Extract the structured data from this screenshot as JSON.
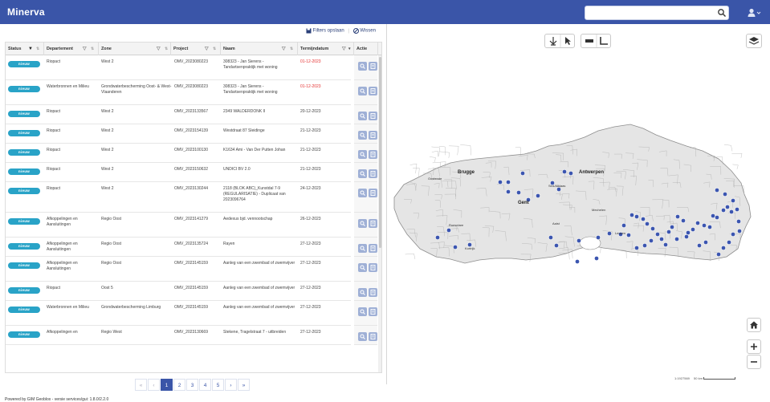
{
  "app": {
    "title": "Minerva"
  },
  "search": {
    "placeholder": "",
    "value": ""
  },
  "filters": {
    "save_label": "Filters opslaan",
    "separator": "|",
    "clear_label": "Wissen"
  },
  "table": {
    "headers": {
      "status": "Status",
      "departement": "Departement",
      "zone": "Zone",
      "project": "Project",
      "naam": "Naam",
      "termijndatum": "Termijndatum",
      "actie": "Actie"
    },
    "rows": [
      {
        "status": "nieuw",
        "departement": "Riopact",
        "zone": "West 2",
        "project": "OMV_2023080223",
        "naam": "308323 - Jan Sierens - Tandartsenpraktijk met woning",
        "termijndatum": "01-12-2023",
        "overdue": true
      },
      {
        "status": "nieuw",
        "departement": "Waterbronnen en Milieu",
        "zone": "Grondwaterbescherming Oost- & West-Vlaanderen",
        "project": "OMV_2023080223",
        "naam": "308323 - Jan Sierens - Tandartsenpraktijk met woning",
        "termijndatum": "01-12-2023",
        "overdue": true
      },
      {
        "status": "nieuw",
        "departement": "Riopact",
        "zone": "West 2",
        "project": "OMV_2023133567",
        "naam": "2349 WALDERDONK II",
        "termijndatum": "20-12-2023",
        "overdue": false
      },
      {
        "status": "nieuw",
        "departement": "Riopact",
        "zone": "West 2",
        "project": "OMV_2023154139",
        "naam": "Westdraat 87 Sleidinge",
        "termijndatum": "21-12-2023",
        "overdue": false
      },
      {
        "status": "nieuw",
        "departement": "Riopact",
        "zone": "West 2",
        "project": "OMV_2023100130",
        "naam": "K1634 Ami - Van Der Putten Johan",
        "termijndatum": "21-12-2023",
        "overdue": false
      },
      {
        "status": "nieuw",
        "departement": "Riopact",
        "zone": "West 2",
        "project": "OMV_2023150632",
        "naam": "UNDICI BV 2.0",
        "termijndatum": "21-12-2023",
        "overdue": false
      },
      {
        "status": "nieuw",
        "departement": "Riopact",
        "zone": "West 2",
        "project": "OMV_2023130244",
        "naam": "2118 (BLOK ABC)_Kunstdal 7-9 (REGULARISATIE) - Duplicaat van 2023096764",
        "termijndatum": "24-12-2023",
        "overdue": false
      },
      {
        "status": "nieuw",
        "departement": "Afkoppelingen en Aansluitingen",
        "zone": "Regio Oost",
        "project": "OMV_2023141279",
        "naam": "Aedexus bjd. vennootschap",
        "termijndatum": "26-12-2023",
        "overdue": false
      },
      {
        "status": "nieuw",
        "departement": "Afkoppelingen en Aansluitingen",
        "zone": "Regio Oost",
        "project": "OMV_2023135724",
        "naam": "Rayen",
        "termijndatum": "27-12-2023",
        "overdue": false
      },
      {
        "status": "nieuw",
        "departement": "Afkoppelingen en Aansluitingen",
        "zone": "Regio Oost",
        "project": "OMV_2023145159",
        "naam": "Aanleg van een zwembad of zwemvijver",
        "termijndatum": "27-12-2023",
        "overdue": false
      },
      {
        "status": "nieuw",
        "departement": "Riopact",
        "zone": "Oost 5",
        "project": "OMV_2023145159",
        "naam": "Aanleg van een zwembad of zwemvijver",
        "termijndatum": "27-12-2023",
        "overdue": false
      },
      {
        "status": "nieuw",
        "departement": "Waterbronnen en Milieu",
        "zone": "Grondwaterbescherming Limburg",
        "project": "OMV_2023145159",
        "naam": "Aanleg van een zwembad of zwemvijver",
        "termijndatum": "27-12-2023",
        "overdue": false
      },
      {
        "status": "nieuw",
        "departement": "Afkoppelingen en",
        "zone": "Regio West",
        "project": "OMV_2023130669",
        "naam": "Stekene, Tragelstraat 7 - uitbreiden",
        "termijndatum": "27-12-2023",
        "overdue": false
      }
    ]
  },
  "pagination": {
    "first": "«",
    "prev": "‹",
    "pages": [
      "1",
      "2",
      "3",
      "4",
      "5"
    ],
    "current": "1",
    "next": "›",
    "last": "»"
  },
  "footer": {
    "text": "Powered by GIM Geoblox - versie services/gui: 1.8.0/2.2.0"
  },
  "map": {
    "city_labels": [
      "Brugge",
      "Antwerpen",
      "Gent",
      "Oostende",
      "Kortrijk",
      "Mechelen",
      "Aalst",
      "Sint-Niklaas",
      "Roeselare",
      "Leuven"
    ],
    "scale_text": "1:1927569",
    "scale_unit": "50 km",
    "marker_color": "#3b55b0"
  },
  "colors": {
    "brand": "#3a55a8",
    "badge": "#29a3c7",
    "overdue": "#e53030",
    "action_button": "#9fb0d6"
  }
}
